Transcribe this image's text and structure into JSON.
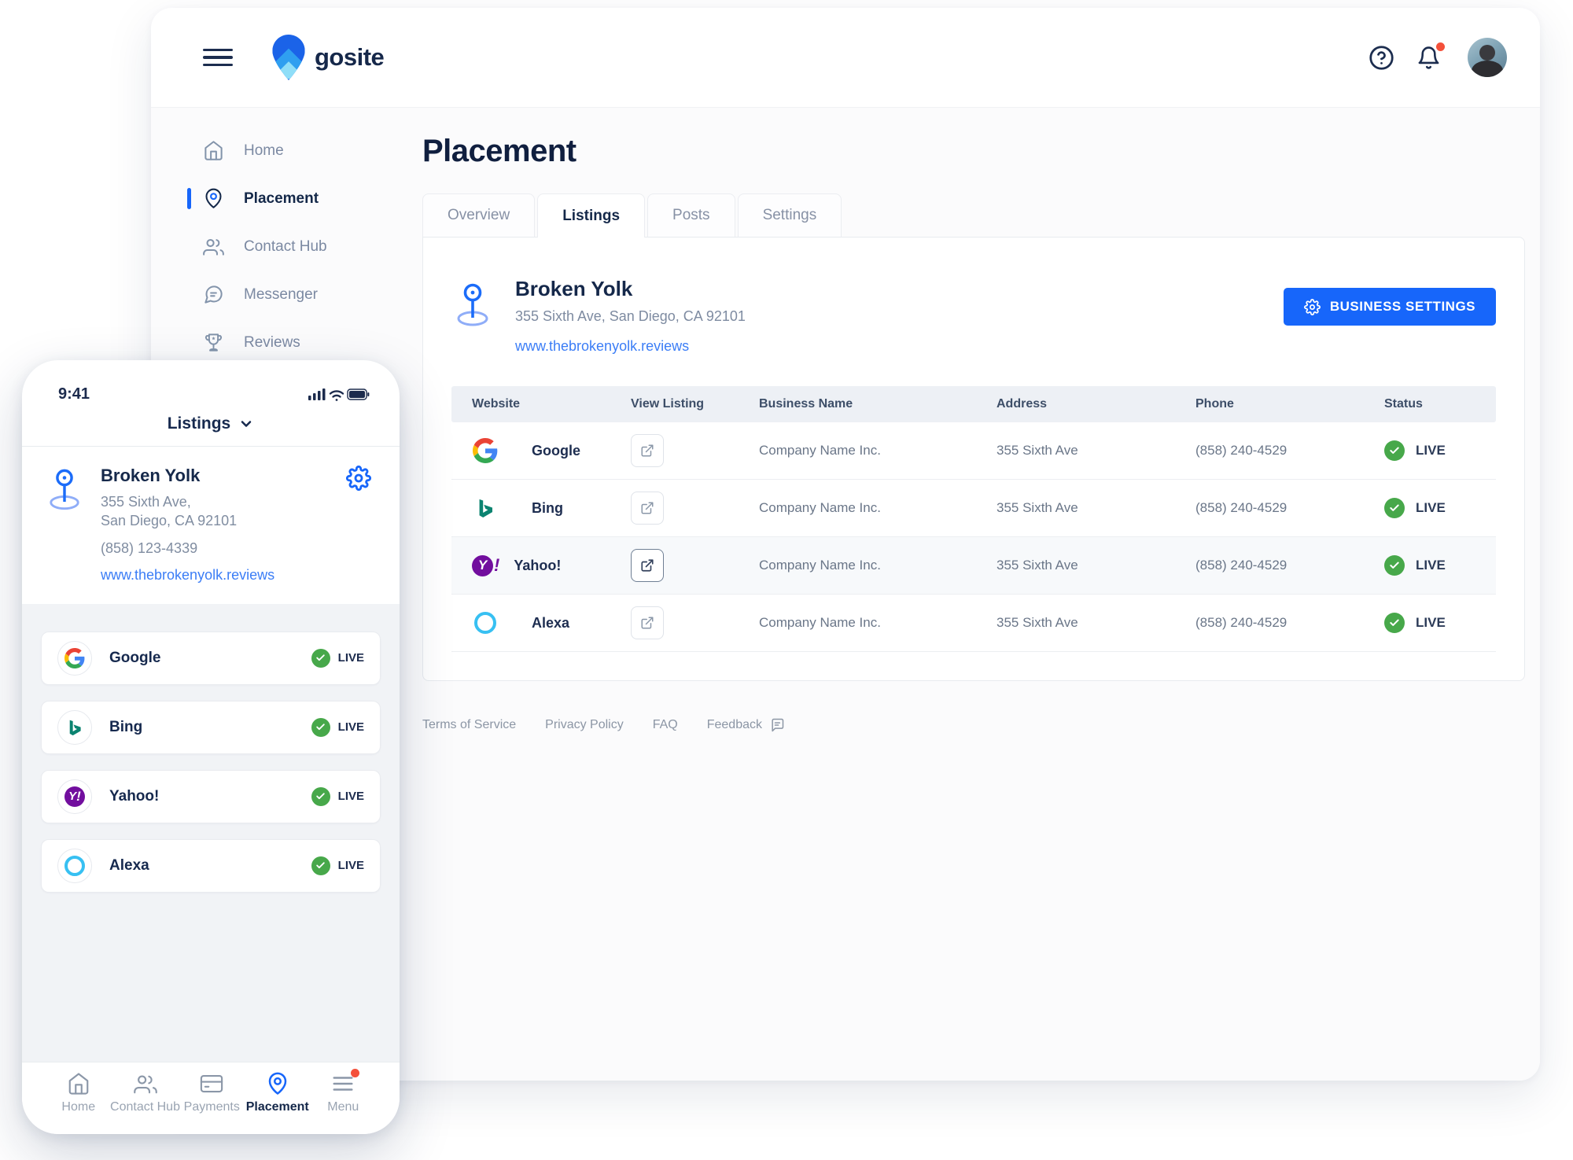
{
  "colors": {
    "accent_blue": "#1766fa",
    "navy_text": "#15294e",
    "live_green": "#47a84a",
    "notification_red": "#f4503a",
    "link_blue": "#3b7df6",
    "yahoo_purple": "#720e9e",
    "bing_teal": "#007c70",
    "alexa_blue": "#37c0f2"
  },
  "desktop": {
    "logo_text": "gosite",
    "page_title": "Placement",
    "sidebar": {
      "items": [
        {
          "label": "Home"
        },
        {
          "label": "Placement"
        },
        {
          "label": "Contact Hub"
        },
        {
          "label": "Messenger"
        },
        {
          "label": "Reviews"
        }
      ]
    },
    "tabs": [
      {
        "label": "Overview"
      },
      {
        "label": "Listings"
      },
      {
        "label": "Posts"
      },
      {
        "label": "Settings"
      }
    ],
    "business": {
      "name": "Broken Yolk",
      "address": "355 Sixth Ave, San Diego, CA 92101",
      "website": "www.thebrokenyolk.reviews",
      "settings_button": "BUSINESS SETTINGS"
    },
    "table": {
      "columns": [
        "Website",
        "View Listing",
        "Business Name",
        "Address",
        "Phone",
        "Status"
      ],
      "rows": [
        {
          "site": "Google",
          "company": "Company Name Inc.",
          "address": "355 Sixth Ave",
          "phone": "(858) 240-4529",
          "status": "LIVE"
        },
        {
          "site": "Bing",
          "company": "Company Name Inc.",
          "address": "355 Sixth Ave",
          "phone": "(858) 240-4529",
          "status": "LIVE"
        },
        {
          "site": "Yahoo!",
          "company": "Company Name Inc.",
          "address": "355 Sixth Ave",
          "phone": "(858) 240-4529",
          "status": "LIVE"
        },
        {
          "site": "Alexa",
          "company": "Company Name Inc.",
          "address": "355 Sixth Ave",
          "phone": "(858) 240-4529",
          "status": "LIVE"
        }
      ]
    },
    "footer": {
      "links": [
        "Terms of Service",
        "Privacy Policy",
        "FAQ",
        "Feedback"
      ]
    }
  },
  "phone": {
    "status_time": "9:41",
    "header_title": "Listings",
    "business": {
      "name": "Broken Yolk",
      "address_line1": "355 Sixth Ave,",
      "address_line2": "San Diego, CA 92101",
      "phone": "(858) 123-4339",
      "website": "www.thebrokenyolk.reviews"
    },
    "listings": [
      {
        "site": "Google",
        "status": "LIVE"
      },
      {
        "site": "Bing",
        "status": "LIVE"
      },
      {
        "site": "Yahoo!",
        "status": "LIVE"
      },
      {
        "site": "Alexa",
        "status": "LIVE"
      }
    ],
    "bottom_nav": [
      {
        "label": "Home"
      },
      {
        "label": "Contact Hub"
      },
      {
        "label": "Payments"
      },
      {
        "label": "Placement"
      },
      {
        "label": "Menu"
      }
    ]
  }
}
